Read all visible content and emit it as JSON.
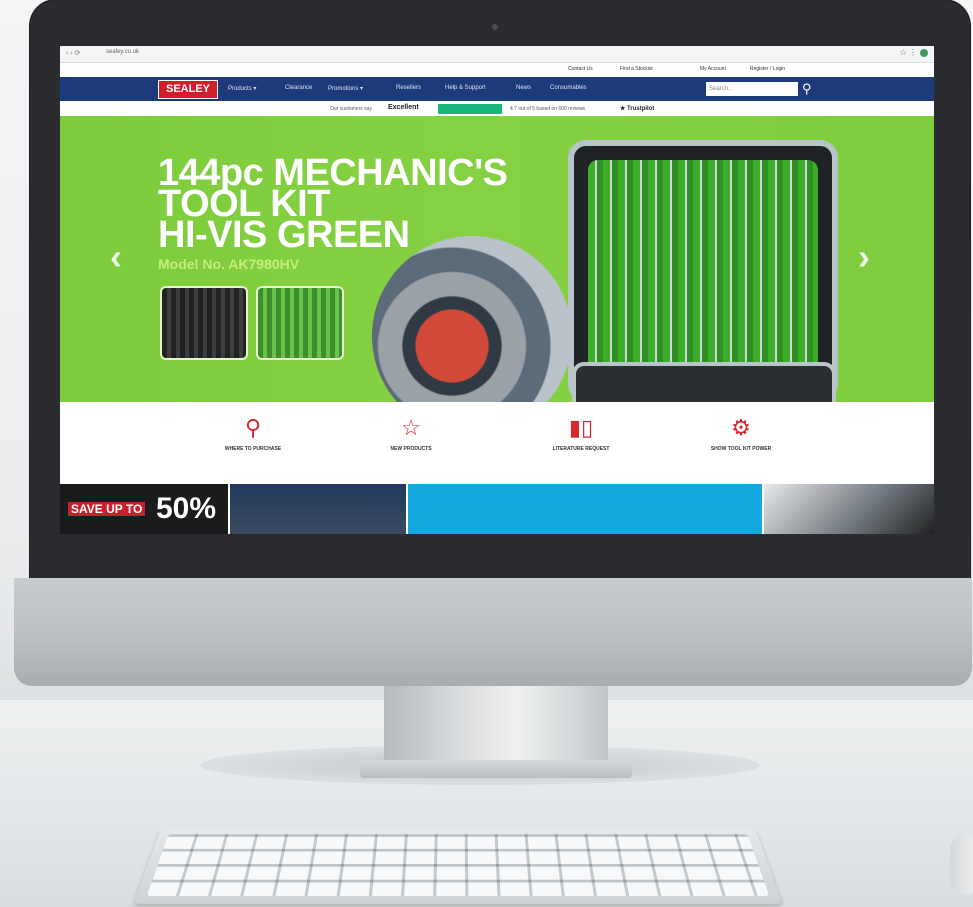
{
  "browser": {
    "nav": "‹ › ⟳",
    "url": "sealey.co.uk",
    "right": "☆ ⋮"
  },
  "top_links": [
    "Contact Us",
    "Find a Stockist",
    "My Account",
    "Register / Login"
  ],
  "nav": {
    "logo": "SEALEY",
    "items": [
      "Products ▾",
      "Clearance",
      "Promotions ▾",
      "Resellers",
      "Help & Support",
      "News",
      "Consumables"
    ],
    "search_placeholder": "Search..."
  },
  "trustbar": {
    "intro": "Our customers say",
    "rating_word": "Excellent",
    "score": "4.7 out of 5 based on 600 reviews",
    "brand": "★ Trustpilot"
  },
  "banner": {
    "headline": [
      "144pc MECHANIC'S",
      "TOOL KIT",
      "HI-VIS GREEN"
    ],
    "model": "Model No. AK7980HV"
  },
  "features": [
    {
      "icon": "map-pin-icon",
      "glyph": "⚲",
      "label": "WHERE TO PURCHASE"
    },
    {
      "icon": "star-icon",
      "glyph": "☆",
      "label": "NEW PRODUCTS"
    },
    {
      "icon": "catalogue-icon",
      "glyph": "▮▯",
      "label": "LITERATURE REQUEST"
    },
    {
      "icon": "gear-icon",
      "glyph": "⚙",
      "label": "SHOW TOOL KIT POWER"
    }
  ],
  "promo": {
    "save": "SAVE UP TO",
    "pct": "50%"
  },
  "colors": {
    "nav": "#1d3a7a",
    "banner": "#7ccc3c",
    "accent": "#d8262e"
  }
}
